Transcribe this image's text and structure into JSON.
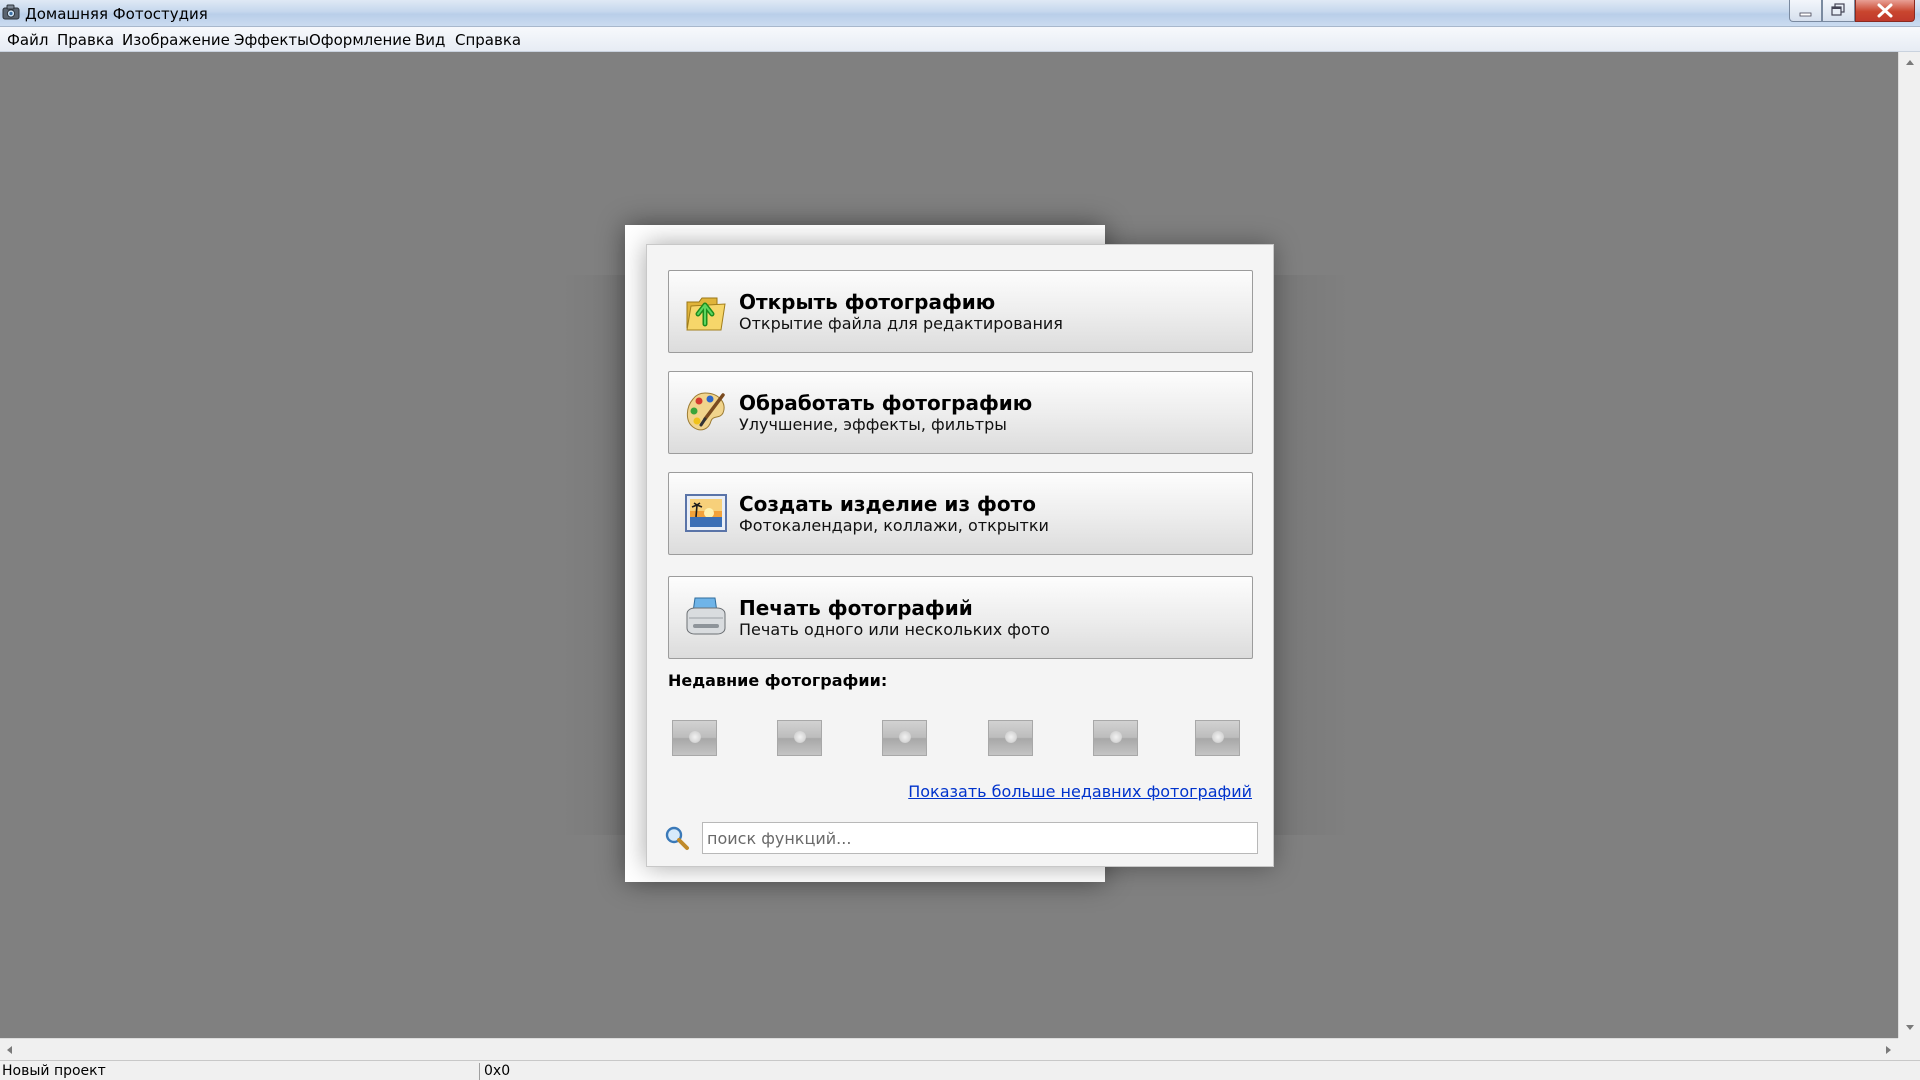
{
  "window": {
    "title": "Домашняя Фотостудия",
    "icon": "camera-icon",
    "controls": [
      "minimize-icon",
      "maximize-icon",
      "close-icon"
    ]
  },
  "menu": [
    {
      "label": "Файл"
    },
    {
      "label": "Правка"
    },
    {
      "label": "Изображение"
    },
    {
      "label": "Эффекты"
    },
    {
      "label": "Оформление"
    },
    {
      "label": "Вид"
    },
    {
      "label": "Справка"
    }
  ],
  "start_panel": {
    "actions": [
      {
        "title": "Открыть фотографию",
        "subtitle": "Открытие файла для редактирования",
        "icon": "open-folder-icon"
      },
      {
        "title": "Обработать фотографию",
        "subtitle": "Улучшение, эффекты, фильтры",
        "icon": "palette-icon"
      },
      {
        "title": "Создать изделие из фото",
        "subtitle": "Фотокалендари, коллажи, открытки",
        "icon": "picture-icon"
      },
      {
        "title": "Печать фотографий",
        "subtitle": "Печать одного или нескольких фото",
        "icon": "printer-icon"
      }
    ],
    "recent_label": "Недавние фотографии:",
    "recent_thumbnail_count": 6,
    "more_link": "Показать больше недавних фотографий",
    "search": {
      "placeholder": "поиск функций...",
      "value": "",
      "icon": "search-icon"
    }
  },
  "status": {
    "project": "Новый проект",
    "size": "0x0"
  },
  "colors": {
    "workspace": "#808080",
    "link": "#0033cc",
    "panel": "#f4f4f4"
  }
}
